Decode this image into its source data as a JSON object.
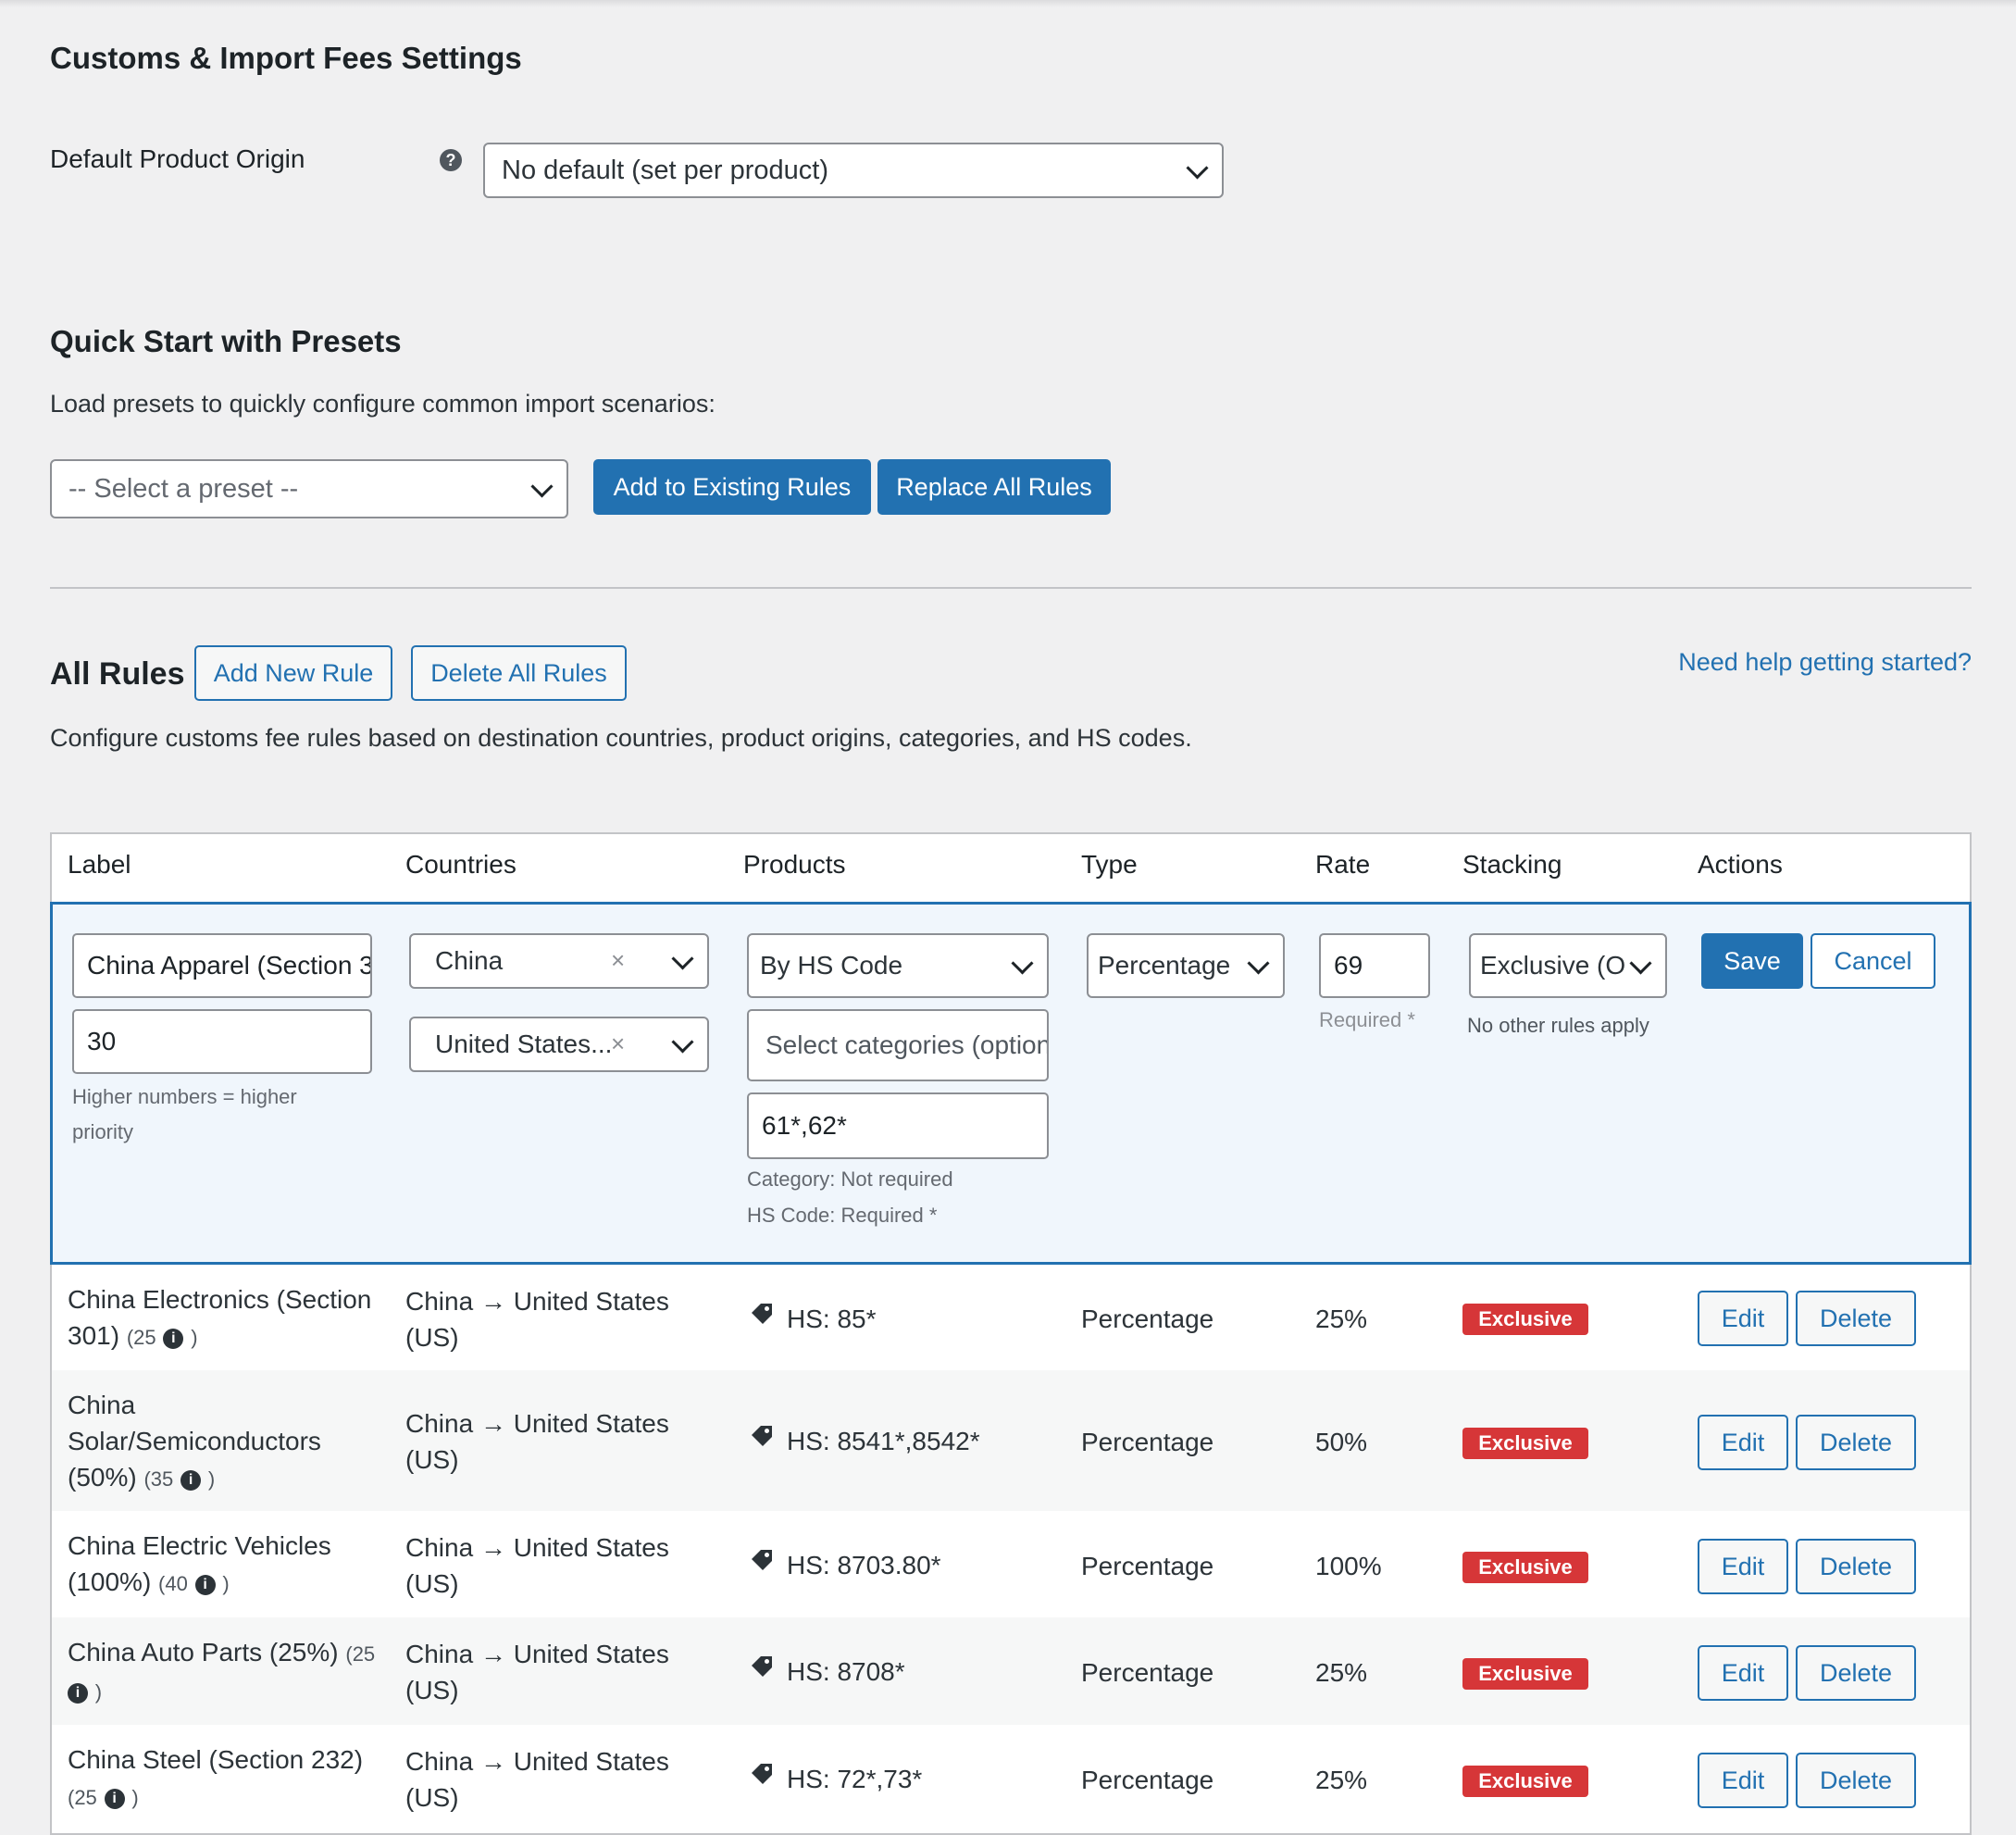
{
  "page": {
    "title": "Customs & Import Fees Settings"
  },
  "origin": {
    "label": "Default Product Origin",
    "help_icon": "help-icon",
    "selected": "No default (set per product)"
  },
  "presets": {
    "title": "Quick Start with Presets",
    "description": "Load presets to quickly configure common import scenarios:",
    "placeholder": "-- Select a preset --",
    "add_label": "Add to Existing Rules",
    "replace_label": "Replace All Rules"
  },
  "rules": {
    "title": "All Rules",
    "add_label": "Add New Rule",
    "delete_all_label": "Delete All Rules",
    "help_link": "Need help getting started?",
    "description": "Configure customs fee rules based on destination countries, product origins, categories, and HS codes."
  },
  "table": {
    "headers": [
      "Label",
      "Countries",
      "Products",
      "Type",
      "Rate",
      "Stacking",
      "Actions"
    ]
  },
  "edit_row": {
    "label_value": "China Apparel (Section 3",
    "priority_value": "30",
    "priority_help": "Higher numbers = higher",
    "priority_help_2": "priority",
    "origin_country": "China",
    "destination_country": "United States...",
    "products_mode": "By HS Code",
    "categories_placeholder": "Select categories (option",
    "hs_codes": "61*,62*",
    "category_note": "Category: Not required",
    "hs_note": "HS Code: Required *",
    "type": "Percentage",
    "rate": "69",
    "rate_note": "Required *",
    "stacking": "Exclusive (O",
    "stacking_note": "No other rules apply",
    "save_label": "Save",
    "cancel_label": "Cancel"
  },
  "rows": [
    {
      "label_1": "China Electronics (Section",
      "label_2": "301)",
      "priority": "(25",
      "countries_1": "China → United States",
      "countries_2": "(US)",
      "products": "HS: 85*",
      "type": "Percentage",
      "rate": "25%",
      "stacking": "Exclusive",
      "edit": "Edit",
      "delete": "Delete"
    },
    {
      "label_1": "China",
      "label_2": "Solar/Semiconductors",
      "label_3": "(50%)",
      "priority": "(35",
      "countries_1": "China → United States",
      "countries_2": "(US)",
      "products": "HS: 8541*,8542*",
      "type": "Percentage",
      "rate": "50%",
      "stacking": "Exclusive",
      "edit": "Edit",
      "delete": "Delete"
    },
    {
      "label_1": "China Electric Vehicles",
      "label_2": "(100%)",
      "priority": "(40",
      "countries_1": "China → United States",
      "countries_2": "(US)",
      "products": "HS: 8703.80*",
      "type": "Percentage",
      "rate": "100%",
      "stacking": "Exclusive",
      "edit": "Edit",
      "delete": "Delete"
    },
    {
      "label_1": "China Auto Parts (25%)",
      "priority": "(25",
      "countries_1": "China → United States",
      "countries_2": "(US)",
      "products": "HS: 8708*",
      "type": "Percentage",
      "rate": "25%",
      "stacking": "Exclusive",
      "edit": "Edit",
      "delete": "Delete"
    },
    {
      "label_1": "China Steel (Section 232)",
      "priority": "(25",
      "countries_1": "China → United States",
      "countries_2": "(US)",
      "products": "HS: 72*,73*",
      "type": "Percentage",
      "rate": "25%",
      "stacking": "Exclusive",
      "edit": "Edit",
      "delete": "Delete"
    }
  ],
  "colors": {
    "primary": "#2271b1",
    "danger": "#d63638",
    "background": "#f0f0f1"
  }
}
